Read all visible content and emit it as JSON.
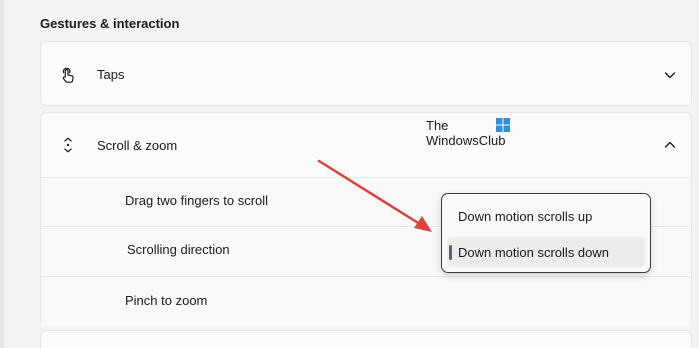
{
  "section": {
    "title": "Gestures & interaction"
  },
  "taps": {
    "label": "Taps",
    "icon": "tap-icon",
    "chevron": "chevron-down-icon"
  },
  "scroll_zoom": {
    "label": "Scroll & zoom",
    "icon": "scroll-updown-icon",
    "chevron": "chevron-up-icon",
    "settings": [
      {
        "label": "Drag two fingers to scroll"
      },
      {
        "label": "Scrolling direction"
      },
      {
        "label": "Pinch to zoom"
      }
    ]
  },
  "dropdown": {
    "options": [
      {
        "label": "Down motion scrolls up",
        "selected": false
      },
      {
        "label": "Down motion scrolls down",
        "selected": true
      }
    ]
  },
  "watermark": {
    "line1": "The",
    "line2": "WindowsClub"
  },
  "colors": {
    "arrow": "#e0403a",
    "selected_indicator": "#5a6270",
    "card_bg": "#fbfbfb",
    "page_bg": "#f3f3f3"
  }
}
